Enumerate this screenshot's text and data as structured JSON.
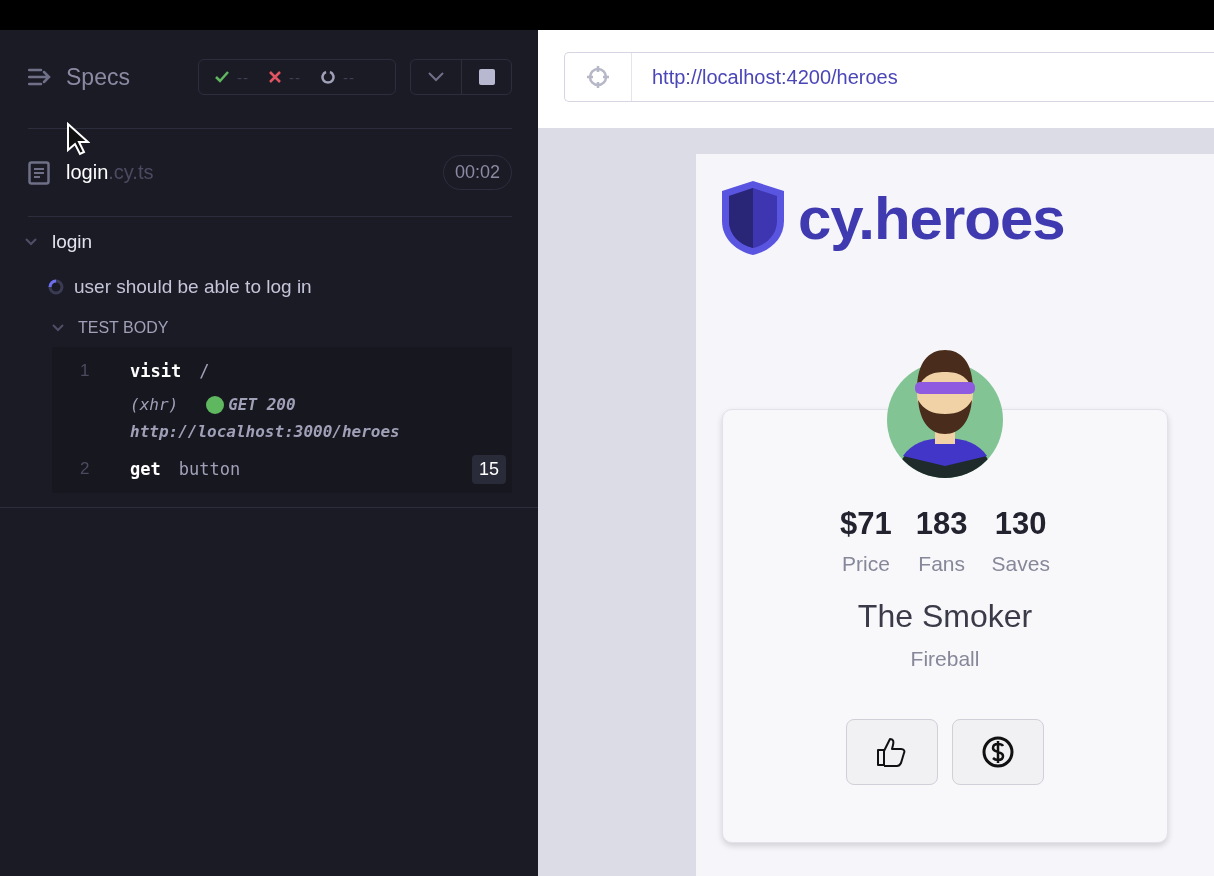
{
  "specs_panel": {
    "title": "Specs",
    "stats": [
      {
        "kind": "passed",
        "count": "--"
      },
      {
        "kind": "failed",
        "count": "--"
      },
      {
        "kind": "pending",
        "count": "--"
      }
    ],
    "spec_file": {
      "name": "login",
      "extension": ".cy.ts",
      "duration": "00:02"
    },
    "suite": {
      "title": "login",
      "expanded": true,
      "test": {
        "title": "user should be able to log in",
        "running": true,
        "section": {
          "label": "TEST BODY",
          "expanded": true,
          "commands": [
            {
              "kind": "command",
              "number": "1",
              "name": "visit",
              "message": "/"
            },
            {
              "kind": "request",
              "type": "(xhr)",
              "status": "GET 200",
              "url": "http://localhost:3000/heroes"
            },
            {
              "kind": "command",
              "number": "2",
              "name": "get",
              "message": "button",
              "badge": "15"
            }
          ]
        }
      }
    }
  },
  "browser": {
    "url": "http://localhost:4200/heroes"
  },
  "app": {
    "logo": "cy.heroes",
    "hero": {
      "stats": [
        {
          "value": "$71",
          "label": "Price"
        },
        {
          "value": "183",
          "label": "Fans"
        },
        {
          "value": "130",
          "label": "Saves"
        }
      ],
      "name": "The Smoker",
      "power": "Fireball"
    }
  }
}
